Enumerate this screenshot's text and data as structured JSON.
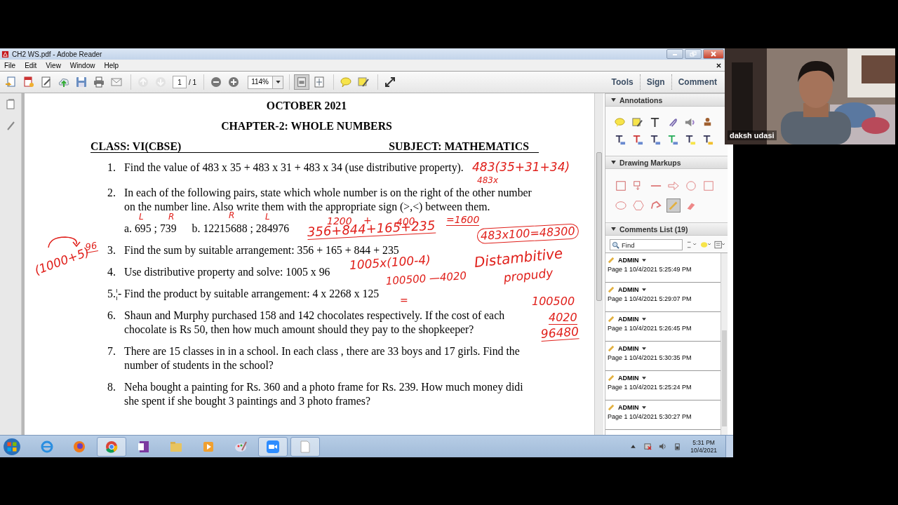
{
  "window": {
    "title": "CH2 WS.pdf - Adobe Reader"
  },
  "menu": [
    "File",
    "Edit",
    "View",
    "Window",
    "Help"
  ],
  "toolbar": {
    "page": "1",
    "page_count": "/ 1",
    "zoom": "114%"
  },
  "task_buttons": [
    "Tools",
    "Sign",
    "Comment"
  ],
  "document": {
    "heading": "OCTOBER 2021",
    "chapter": "CHAPTER-2: WHOLE NUMBERS",
    "class": "CLASS: VI(CBSE)",
    "subject": "SUBJECT: MATHEMATICS",
    "questions": [
      {
        "number": "1.",
        "text": "Find the value of 483 x 35 + 483 x 31 + 483 x 34 (use distributive property)."
      },
      {
        "number": "2.",
        "text": "In each of the following pairs, state which whole number is on the right of the other number on the number line. Also write them with the appropriate sign (>,<) between them.",
        "parts": [
          "a. 695 ; 739",
          "b. 12215688 ; 284976"
        ]
      },
      {
        "number": "3.",
        "text": "Find the sum by suitable arrangement: 356 + 165 + 844 + 235"
      },
      {
        "number": "4.",
        "text": "Use distributive property and solve:  1005 x 96"
      },
      {
        "number": "5.¦-",
        "text": "Find the product by suitable arrangement:  4 x 2268 x 125"
      },
      {
        "number": "6.",
        "text": "Shaun and Murphy purchased 158 and 142 chocolates respectively. If the cost of each chocolate is Rs 50, then  how much amount should they pay to the shopkeeper?"
      },
      {
        "number": "7.",
        "text": "There are 15 classes in in a school. In each class , there are 33 boys and 17 girls. Find the number of students in the school?"
      },
      {
        "number": "8.",
        "text": "Neha bought a painting for Rs. 360 and a photo frame for Rs. 239. How much money didi she spent if she bought 3 paintings and 3 photo frames?"
      }
    ],
    "ink": [
      {
        "text": "483(35+31+34)",
        "kind": "plain"
      },
      {
        "text": "483x",
        "kind": "plain"
      },
      {
        "text": "L",
        "kind": "plain"
      },
      {
        "text": "R",
        "kind": "plain"
      },
      {
        "text": "R",
        "kind": "plain"
      },
      {
        "text": "L",
        "kind": "plain"
      },
      {
        "text": "1200",
        "kind": "plain"
      },
      {
        "text": "+",
        "kind": "plain"
      },
      {
        "text": "400",
        "kind": "plain"
      },
      {
        "text": "=1600",
        "kind": "underlined"
      },
      {
        "text": "356+844+165+235",
        "kind": "underlined"
      },
      {
        "text": "483x100=48300",
        "kind": "boxed"
      },
      {
        "text": "96",
        "kind": "underlined"
      },
      {
        "text": "(1000+5)",
        "kind": "plain"
      },
      {
        "text": "1005x(100-4)",
        "kind": "plain"
      },
      {
        "text": "Distambitive",
        "kind": "plain"
      },
      {
        "text": "100500 —4020",
        "kind": "plain"
      },
      {
        "text": "propudy",
        "kind": "plain"
      },
      {
        "text": "=",
        "kind": "plain"
      },
      {
        "text": "100500",
        "kind": "plain"
      },
      {
        "text": "4020",
        "kind": "underlined"
      },
      {
        "text": "96480",
        "kind": "underlined"
      }
    ]
  },
  "panel": {
    "annotations": {
      "title": "Annotations"
    },
    "drawing_markups": {
      "title": "Drawing Markups",
      "tools": [
        {
          "selected": false
        },
        {
          "selected": false
        },
        {
          "selected": false
        },
        {
          "selected": false
        },
        {
          "selected": false
        },
        {
          "selected": false
        },
        {
          "selected": false
        },
        {
          "selected": false
        },
        {
          "selected": false
        },
        {
          "selected": true
        },
        {
          "selected": false
        }
      ]
    },
    "comments": {
      "title": "Comments List (19)",
      "search": {
        "placeholder": "Find"
      },
      "items": [
        {
          "author": "ADMIN",
          "meta": "Page 1  10/4/2021 5:25:49 PM"
        },
        {
          "author": "ADMIN",
          "meta": "Page 1  10/4/2021 5:29:07 PM"
        },
        {
          "author": "ADMIN",
          "meta": "Page 1  10/4/2021 5:26:45 PM"
        },
        {
          "author": "ADMIN",
          "meta": "Page 1  10/4/2021 5:30:35 PM"
        },
        {
          "author": "ADMIN",
          "meta": "Page 1  10/4/2021 5:25:24 PM"
        },
        {
          "author": "ADMIN",
          "meta": "Page 1  10/4/2021 5:30:27 PM"
        }
      ]
    }
  },
  "taskbar": {
    "apps": [
      {
        "selected": false
      },
      {
        "selected": false
      },
      {
        "selected": true
      },
      {
        "selected": false
      },
      {
        "selected": false
      },
      {
        "selected": false
      },
      {
        "selected": false
      },
      {
        "selected": true
      },
      {
        "selected": true
      }
    ],
    "time": "5:31 PM",
    "date": "10/4/2021"
  },
  "webcam": {
    "kind": "picture",
    "name": "daksh udasi"
  }
}
